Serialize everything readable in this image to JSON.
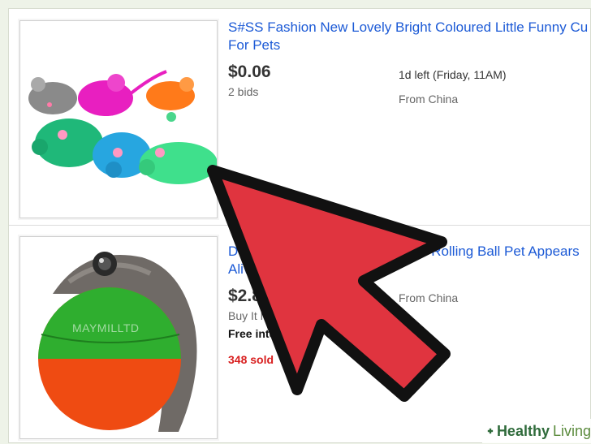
{
  "listings": [
    {
      "title_line1": "S#SS Fashion New Lovely Bright Coloured Little Funny Cu",
      "title_line2": "For Pets",
      "price": "$0.06",
      "bids": "2 bids",
      "time_left": "1d left (Friday, 11AM)",
      "location": "From China"
    },
    {
      "title_line1_start": "D",
      "title_line1_end": "Rolling Ball Pet Appears",
      "title_line2": "Aliv",
      "price": "$2.8",
      "format": "Buy It N",
      "shipping": "Free inter",
      "sold": "348 sold",
      "location": "From China",
      "image_watermark": "MAYMILLTD"
    }
  ],
  "brand": {
    "part1": "Healthy",
    "part2": "Living"
  },
  "colors": {
    "link": "#1c5ad6",
    "sold": "#d81e1e",
    "arrow": "#e0343f"
  }
}
